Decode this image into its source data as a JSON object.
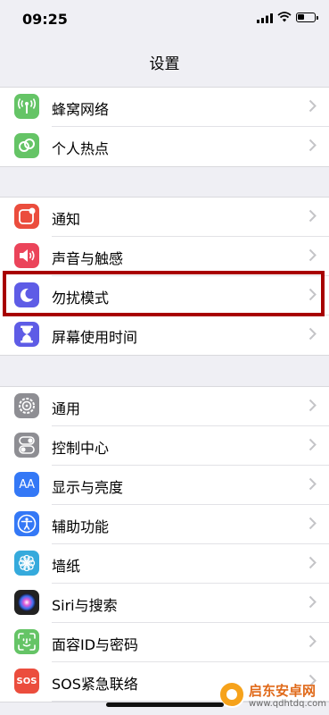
{
  "status_bar": {
    "time": "09:25"
  },
  "nav": {
    "title": "设置"
  },
  "group1": [
    {
      "label": "蜂窝网络",
      "icon": "cellular-antenna-icon",
      "color": "#65c466"
    },
    {
      "label": "个人热点",
      "icon": "hotspot-link-icon",
      "color": "#65c466"
    }
  ],
  "group2": [
    {
      "label": "通知",
      "icon": "notifications-icon",
      "color": "#eb4d3d"
    },
    {
      "label": "声音与触感",
      "icon": "speaker-icon",
      "color": "#eb445a"
    },
    {
      "label": "勿扰模式",
      "icon": "moon-icon",
      "color": "#5e5ce6"
    },
    {
      "label": "屏幕使用时间",
      "icon": "hourglass-icon",
      "color": "#5e5ce6"
    }
  ],
  "group3": [
    {
      "label": "通用",
      "icon": "gear-icon",
      "color": "#8e8e93"
    },
    {
      "label": "控制中心",
      "icon": "toggles-icon",
      "color": "#8e8e93"
    },
    {
      "label": "显示与亮度",
      "icon": "text-size-icon",
      "color": "#3478f6",
      "glyph": "AA"
    },
    {
      "label": "辅助功能",
      "icon": "accessibility-icon",
      "color": "#3478f6"
    },
    {
      "label": "墙纸",
      "icon": "flower-icon",
      "color": "#35aadc"
    },
    {
      "label": "Siri与搜索",
      "icon": "siri-icon",
      "color": "#222222"
    },
    {
      "label": "面容ID与密码",
      "icon": "face-id-icon",
      "color": "#65c466"
    },
    {
      "label": "SOS紧急联络",
      "icon": "sos-icon",
      "color": "#eb4d3d",
      "glyph": "SOS"
    }
  ],
  "watermark": {
    "title": "启东安卓网",
    "url": "www.qdhtdq.com"
  }
}
